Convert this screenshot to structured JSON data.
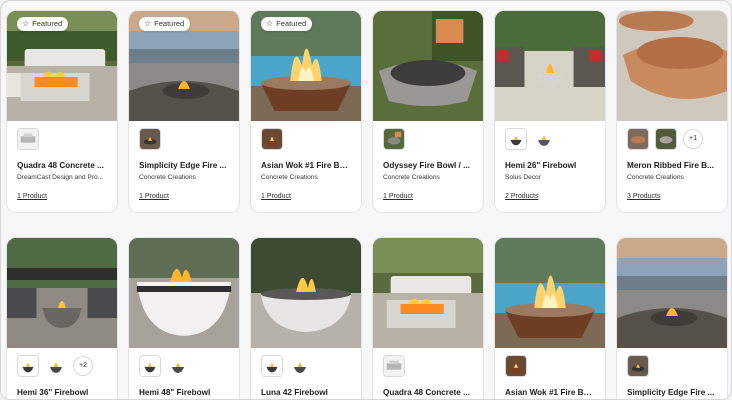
{
  "featured_label": "Featured",
  "products": [
    {
      "name": "Quadra 48 Concrete ...",
      "brand": "DreamCast Design and Pro...",
      "count": "1 Product",
      "featured": true,
      "extra": ""
    },
    {
      "name": "Simplicity Edge Fire ...",
      "brand": "Concrete Creations",
      "count": "1 Product",
      "featured": true,
      "extra": ""
    },
    {
      "name": "Asian Wok #1 Fire Bo...",
      "brand": "Concrete Creations",
      "count": "1 Product",
      "featured": true,
      "extra": ""
    },
    {
      "name": "Odyssey Fire Bowl / ...",
      "brand": "Concrete Creations",
      "count": "1 Product",
      "featured": false,
      "extra": ""
    },
    {
      "name": "Hemi 26\" Firebowl",
      "brand": "Solus Decor",
      "count": "2 Products",
      "featured": false,
      "extra": ""
    },
    {
      "name": "Meron Ribbed Fire B...",
      "brand": "Concrete Creations",
      "count": "3 Products",
      "featured": false,
      "extra": "+1"
    },
    {
      "name": "Hemi 36\" Firebowl",
      "brand": "",
      "count": "",
      "featured": false,
      "extra": "+2"
    },
    {
      "name": "Hemi 48\" Firebowl",
      "brand": "",
      "count": "",
      "featured": false,
      "extra": ""
    },
    {
      "name": "Luna 42 Firebowl",
      "brand": "",
      "count": "",
      "featured": false,
      "extra": ""
    },
    {
      "name": "Quadra 48 Concrete ...",
      "brand": "",
      "count": "",
      "featured": false,
      "extra": ""
    },
    {
      "name": "Asian Wok #1 Fire Bo...",
      "brand": "",
      "count": "",
      "featured": false,
      "extra": ""
    },
    {
      "name": "Simplicity Edge Fire ...",
      "brand": "",
      "count": "",
      "featured": false,
      "extra": ""
    }
  ]
}
